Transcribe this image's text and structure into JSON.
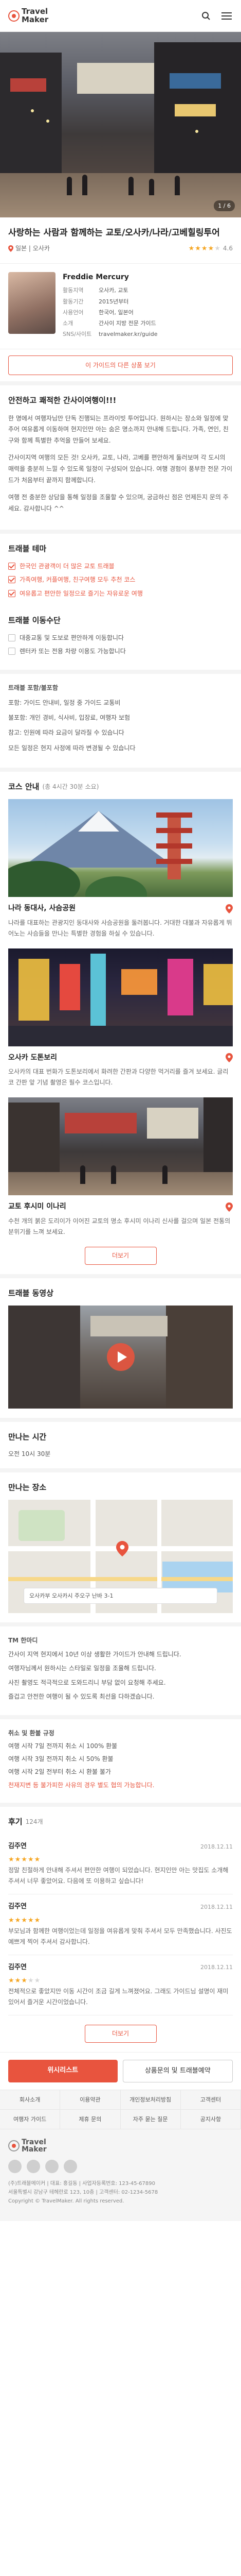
{
  "header": {
    "logo_line1": "Travel",
    "logo_line2": "Maker"
  },
  "hero": {
    "pager": "1 / 6"
  },
  "tour": {
    "title": "사랑하는 사람과 함께하는 교토/오사카/나라/고베힐링투어",
    "location": "일본 | 오사카",
    "rating": 4,
    "rating_text": "4.6"
  },
  "guide": {
    "name": "Freddie Mercury",
    "rows": [
      {
        "k": "활동지역",
        "v": "오사카, 교토"
      },
      {
        "k": "활동기간",
        "v": "2015년부터"
      },
      {
        "k": "사용언어",
        "v": "한국어, 일본어"
      },
      {
        "k": "소개",
        "v": "간사이 지방 전문 가이드"
      },
      {
        "k": "SNS/사이트",
        "v": "travelmaker.kr/guide"
      }
    ],
    "button": "이 가이드의 다른 상품 보기"
  },
  "intro": {
    "heading": "안전하고 쾌적한 간사이여행이!!!",
    "p1": "한 명에서 여행자님만 단독 진행되는 프라이빗 투어입니다. 원하시는 장소와 일정에 맞추어 여유롭게 이동하며 현지인만 아는 숨은 명소까지 안내해 드립니다. 가족, 연인, 친구와 함께 특별한 추억을 만들어 보세요.",
    "p2": "간사이지역 여행의 모든 것! 오사카, 교토, 나라, 고베를 편안하게 둘러보며 각 도시의 매력을 충분히 느낄 수 있도록 일정이 구성되어 있습니다. 여행 경험이 풍부한 전문 가이드가 처음부터 끝까지 함께합니다.",
    "p3": "여행 전 충분한 상담을 통해 일정을 조율할 수 있으며, 궁금하신 점은 언제든지 문의 주세요. 감사합니다 ^^"
  },
  "themes": {
    "title": "트래블 테마",
    "items": [
      "한국인 관광객이 더 많은 교토 트래블",
      "가족여행, 커플여행, 친구여행 모두 추천 코스",
      "여유롭고 편안한 일정으로 즐기는 자유로운 여행"
    ]
  },
  "moving": {
    "title": "트래블 이동수단",
    "items": [
      "대중교통 및 도보로 편안하게 이동합니다",
      "렌터카 또는 전용 차량 이용도 가능합니다"
    ]
  },
  "includes": {
    "title": "트래블 포함/불포함",
    "items": [
      "포함: 가이드 안내비, 일정 중 가이드 교통비",
      "불포함: 개인 경비, 식사비, 입장료, 여행자 보험",
      "참고: 인원에 따라 요금이 달라질 수 있습니다",
      "모든 일정은 현지 사정에 따라 변경될 수 있습니다"
    ]
  },
  "course": {
    "title": "코스 안내",
    "count": "(총 4시간 30분 소요)",
    "items": [
      {
        "name": "나라 동대사, 사슴공원",
        "desc": "나라를 대표하는 관광지인 동대사와 사슴공원을 둘러봅니다. 거대한 대불과 자유롭게 뛰어노는 사슴들을 만나는 특별한 경험을 하실 수 있습니다."
      },
      {
        "name": "오사카 도톤보리",
        "desc": "오사카의 대표 번화가 도톤보리에서 화려한 간판과 다양한 먹거리를 즐겨 보세요. 글리코 간판 앞 기념 촬영은 필수 코스입니다."
      },
      {
        "name": "교토 후시미 이나리",
        "desc": "수천 개의 붉은 도리이가 이어진 교토의 명소 후시미 이나리 신사를 걸으며 일본 전통의 분위기를 느껴 보세요."
      }
    ],
    "more": "더보기"
  },
  "video": {
    "title": "트래블 동영상"
  },
  "meeting": {
    "title": "만나는 시간",
    "value": "오전 10시 30분"
  },
  "place": {
    "title": "만나는 장소",
    "address": "오사카부 오사카시 주오구 난바 3-1"
  },
  "guide_intro": {
    "title": "TM 한마디",
    "items": [
      "간사이 지역 현지에서 10년 이상 생활한 가이드가 안내해 드립니다.",
      "여행자님께서 원하시는 스타일로 일정을 조율해 드립니다.",
      "사진 촬영도 적극적으로 도와드리니 부담 없이 요청해 주세요.",
      "즐겁고 안전한 여행이 될 수 있도록 최선을 다하겠습니다."
    ]
  },
  "refund": {
    "title": "취소 및 환불 규정",
    "items": [
      "여행 시작 7일 전까지 취소 시 100% 환불",
      "여행 시작 3일 전까지 취소 시 50% 환불",
      "여행 시작 2일 전부터 취소 시 환불 불가"
    ],
    "note": "천재지변 등 불가피한 사유의 경우 별도 협의 가능합니다."
  },
  "reviews": {
    "title": "후기",
    "count": "124개",
    "items": [
      {
        "name": "김주연",
        "date": "2018.12.11",
        "rating": 5,
        "text": "정말 친절하게 안내해 주셔서 편안한 여행이 되었습니다. 현지인만 아는 맛집도 소개해 주셔서 너무 좋았어요. 다음에 또 이용하고 싶습니다!"
      },
      {
        "name": "김주연",
        "date": "2018.12.11",
        "rating": 5,
        "text": "부모님과 함께한 여행이었는데 일정을 여유롭게 맞춰 주셔서 모두 만족했습니다. 사진도 예쁘게 찍어 주셔서 감사합니다."
      },
      {
        "name": "김주연",
        "date": "2018.12.11",
        "rating": 3,
        "text": "전체적으로 좋았지만 이동 시간이 조금 길게 느껴졌어요. 그래도 가이드님 설명이 재미있어서 즐거운 시간이었습니다."
      }
    ],
    "more": "더보기"
  },
  "actions": {
    "wish": "위시리스트",
    "reserve": "상품문의 및 트래블예약"
  },
  "footer_nav": [
    "회사소개",
    "이용약관",
    "개인정보처리방침",
    "고객센터",
    "여행자 가이드",
    "제휴 문의",
    "자주 묻는 질문",
    "공지사항"
  ],
  "footer": {
    "logo1": "Travel",
    "logo2": "Maker",
    "l1": "(주)트래블메이커 | 대표: 홍길동 | 사업자등록번호: 123-45-67890",
    "l2": "서울특별시 강남구 테헤란로 123, 10층 | 고객센터: 02-1234-5678",
    "l3": "Copyright © TravelMaker. All rights reserved."
  }
}
